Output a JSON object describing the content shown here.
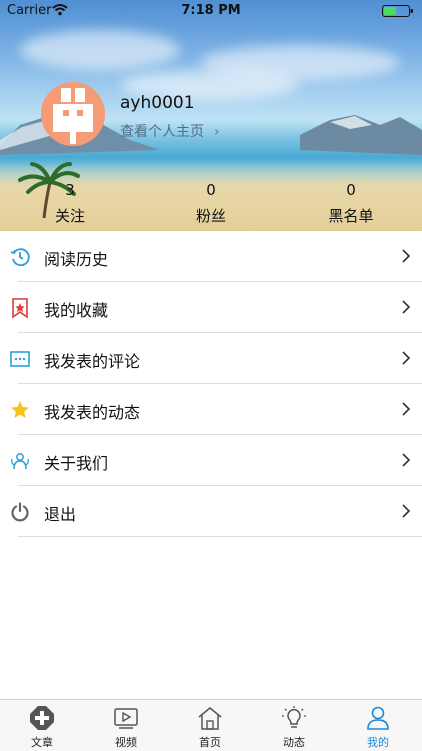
{
  "status_bar": {
    "carrier": "Carrier",
    "time": "7:18 PM"
  },
  "profile": {
    "username": "ayh0001",
    "view_profile_label": "查看个人主页"
  },
  "stats": [
    {
      "count": "3",
      "label": "关注"
    },
    {
      "count": "0",
      "label": "粉丝"
    },
    {
      "count": "0",
      "label": "黑名单"
    }
  ],
  "menu": [
    {
      "label": "阅读历史",
      "icon": "history-clock-icon"
    },
    {
      "label": "我的收藏",
      "icon": "favorite-star-icon"
    },
    {
      "label": "我发表的评论",
      "icon": "comment-icon"
    },
    {
      "label": "我发表的动态",
      "icon": "star-icon"
    },
    {
      "label": "关于我们",
      "icon": "about-icon"
    },
    {
      "label": "退出",
      "icon": "power-icon"
    }
  ],
  "tabs": [
    {
      "label": "文章",
      "icon": "article-icon",
      "active": false
    },
    {
      "label": "视频",
      "icon": "video-icon",
      "active": false
    },
    {
      "label": "首页",
      "icon": "home-icon",
      "active": false
    },
    {
      "label": "动态",
      "icon": "lightbulb-icon",
      "active": false
    },
    {
      "label": "我的",
      "icon": "user-icon",
      "active": true
    }
  ],
  "colors": {
    "accent": "#1e88d8",
    "avatar_bg": "#f59b76",
    "divider": "#dcdcdc"
  }
}
